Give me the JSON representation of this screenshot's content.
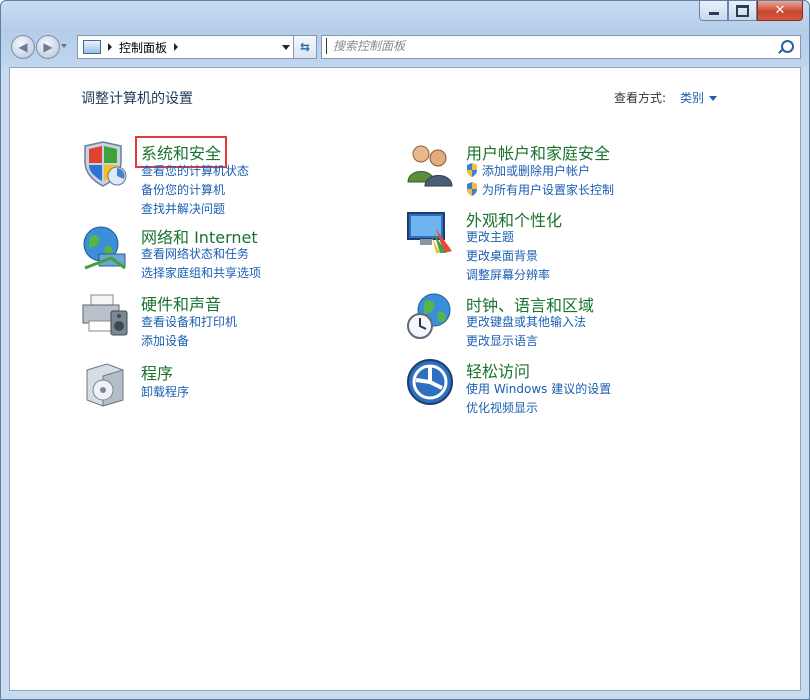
{
  "window": {
    "caption_buttons": [
      "minimize",
      "maximize",
      "close"
    ],
    "close_glyph": "✕"
  },
  "navbar": {
    "breadcrumb": "控制面板",
    "search_placeholder": "搜索控制面板"
  },
  "content": {
    "heading": "调整计算机的设置",
    "view_by_label": "查看方式:",
    "view_by_value": "类别"
  },
  "categories": {
    "system_security": {
      "title": "系统和安全",
      "links": [
        "查看您的计算机状态",
        "备份您的计算机",
        "查找并解决问题"
      ]
    },
    "network": {
      "title": "网络和 Internet",
      "links": [
        "查看网络状态和任务",
        "选择家庭组和共享选项"
      ]
    },
    "hardware": {
      "title": "硬件和声音",
      "links": [
        "查看设备和打印机",
        "添加设备"
      ]
    },
    "programs": {
      "title": "程序",
      "links": [
        "卸载程序"
      ]
    },
    "user_accounts": {
      "title": "用户帐户和家庭安全",
      "links": [
        "添加或删除用户帐户",
        "为所有用户设置家长控制"
      ]
    },
    "appearance": {
      "title": "外观和个性化",
      "links": [
        "更改主题",
        "更改桌面背景",
        "调整屏幕分辨率"
      ]
    },
    "clock_region": {
      "title": "时钟、语言和区域",
      "links": [
        "更改键盘或其他输入法",
        "更改显示语言"
      ]
    },
    "ease_access": {
      "title": "轻松访问",
      "links": [
        "使用 Windows 建议的设置",
        "优化视频显示"
      ]
    }
  },
  "colors": {
    "category_title": "#17732e",
    "link": "#1a5fb4",
    "highlight_box": "#e23b3b"
  }
}
